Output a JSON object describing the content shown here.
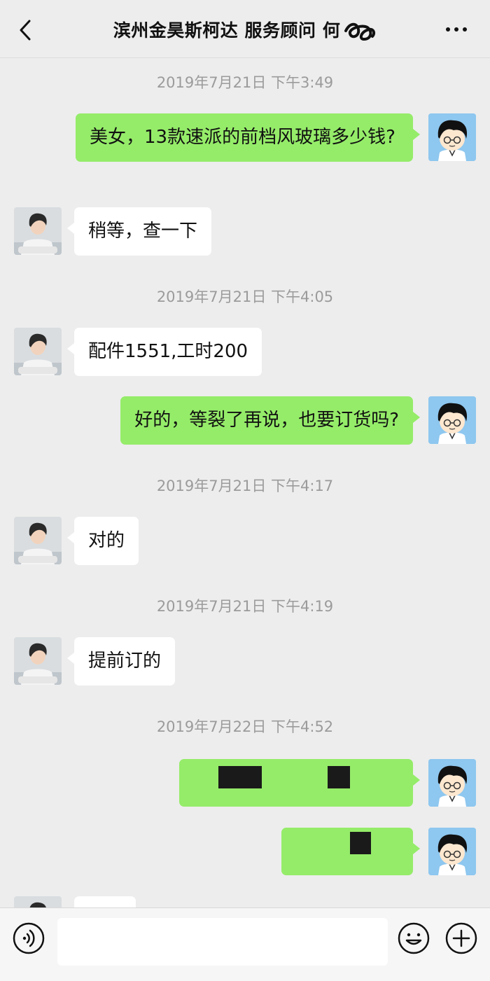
{
  "header": {
    "title": "滨州金昊斯柯达 服务顾问 何",
    "more_label": "•••"
  },
  "messages": [
    {
      "type": "time",
      "text": "2019年7月21日 下午3:49"
    },
    {
      "type": "sent",
      "text": "美女，13款速派的前档风玻璃多少钱?"
    },
    {
      "type": "received",
      "text": "稍等，查一下"
    },
    {
      "type": "time",
      "text": "2019年7月21日 下午4:05"
    },
    {
      "type": "received",
      "text": "配件1551,工时200"
    },
    {
      "type": "sent",
      "text": "好的，等裂了再说，也要订货吗?"
    },
    {
      "type": "time",
      "text": "2019年7月21日 下午4:17"
    },
    {
      "type": "received",
      "text": "对的"
    },
    {
      "type": "time",
      "text": "2019年7月21日 下午4:19"
    },
    {
      "type": "received",
      "text": "提前订的"
    },
    {
      "type": "time",
      "text": "2019年7月22日 下午4:52"
    },
    {
      "type": "sent",
      "text": "(redacted)"
    },
    {
      "type": "sent",
      "text": "(redacted)"
    }
  ],
  "colors": {
    "background": "#ededed",
    "sent_bubble": "#95ec69",
    "received_bubble": "#ffffff",
    "timestamp": "#9b9b9b"
  },
  "icons": {
    "back": "chevron-left-icon",
    "more": "more-dots-icon",
    "voice": "voice-icon",
    "emoji": "emoji-icon",
    "plus": "plus-icon"
  }
}
